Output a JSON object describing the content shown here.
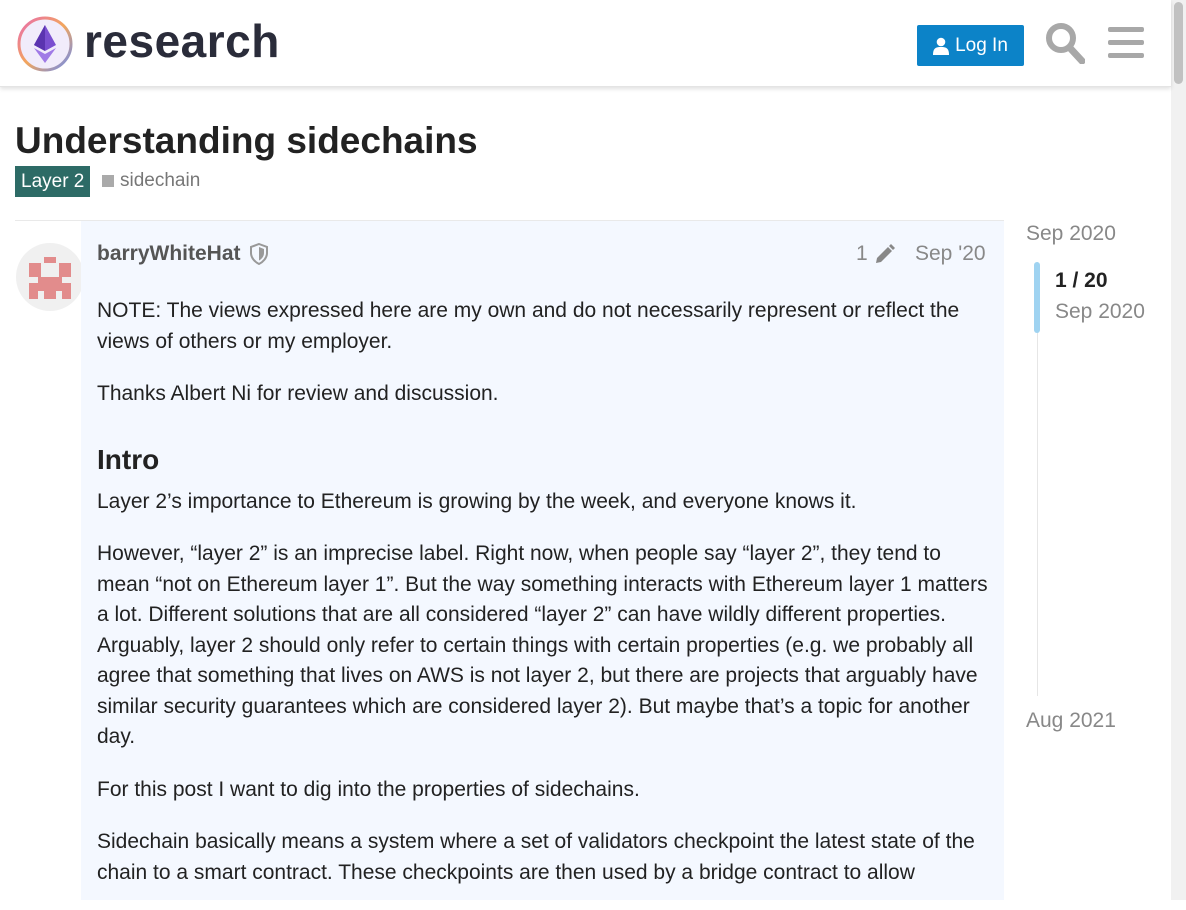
{
  "header": {
    "logo_text": "research",
    "login_label": "Log In"
  },
  "topic": {
    "title": "Understanding sidechains",
    "category": "Layer 2",
    "tags": [
      "sidechain"
    ]
  },
  "post": {
    "username": "barryWhiteHat",
    "edit_count": "1",
    "date": "Sep '20",
    "paragraphs_intro": [
      "NOTE: The views expressed here are my own and do not necessarily represent or reflect the views of others or my employer.",
      "Thanks Albert Ni for review and discussion."
    ],
    "heading": "Intro",
    "paragraphs_body": [
      "Layer 2’s importance to Ethereum is growing by the week, and everyone knows it.",
      "However, “layer 2” is an imprecise label. Right now, when people say “layer 2”, they tend to mean “not on Ethereum layer 1”. But the way something interacts with Ethereum layer 1 matters a lot. Different solutions that are all considered “layer 2” can have wildly different properties. Arguably, layer 2 should only refer to certain things with certain properties (e.g. we probably all agree that something that lives on AWS is not layer 2, but there are projects that arguably have similar security guarantees which are considered layer 2). But maybe that’s a topic for another day.",
      "For this post I want to dig into the properties of sidechains.",
      "Sidechain basically means a system where a set of validators checkpoint the latest state of the chain to a smart contract. These checkpoints are then used by a bridge contract to allow"
    ]
  },
  "timeline": {
    "start_date": "Sep 2020",
    "position": "1 / 20",
    "position_date": "Sep 2020",
    "end_date": "Aug 2021"
  },
  "colors": {
    "accent": "#0c83c8",
    "category": "#2d6b66",
    "post_background": "#f4f8ff",
    "timeline_handle": "#9fd3f1"
  }
}
